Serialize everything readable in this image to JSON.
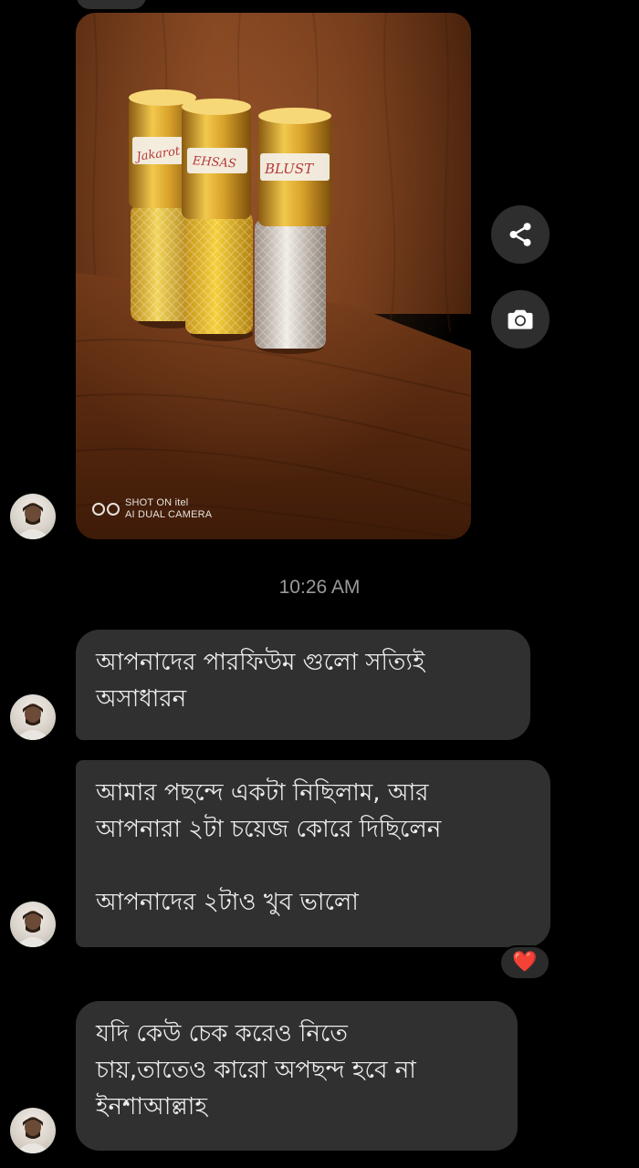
{
  "conversation": {
    "photo": {
      "watermark_line1": "SHOT ON itel",
      "watermark_line2": "AI DUAL CAMERA",
      "bottle_labels": [
        "Jakarot",
        "EHSAS",
        "BLUST"
      ]
    },
    "actions": {
      "share_icon": "share-icon",
      "camera_icon": "camera-icon"
    },
    "timestamp": "10:26 AM",
    "messages": [
      {
        "text": "আপনাদের পারফিউম গুলো সত্যিই\nঅসাধারন"
      },
      {
        "text": "আমার পছন্দে একটা নিছিলাম, আর\nআপনারা ২টা চয়েজ কোরে দিছিলেন\n\nআপনাদের ২টাও খুব ভালো"
      },
      {
        "text": "যদি কেউ চেক করেও নিতে\nচায়,তাতেও কারো অপছন্দ হবে না\nইনশাআল্লাহ"
      }
    ],
    "reaction": "❤️"
  },
  "colors": {
    "background": "#000000",
    "bubble": "#303030",
    "text": "#ececec",
    "timestamp": "#9a9a9a",
    "reaction_heart": "#e0182d"
  }
}
